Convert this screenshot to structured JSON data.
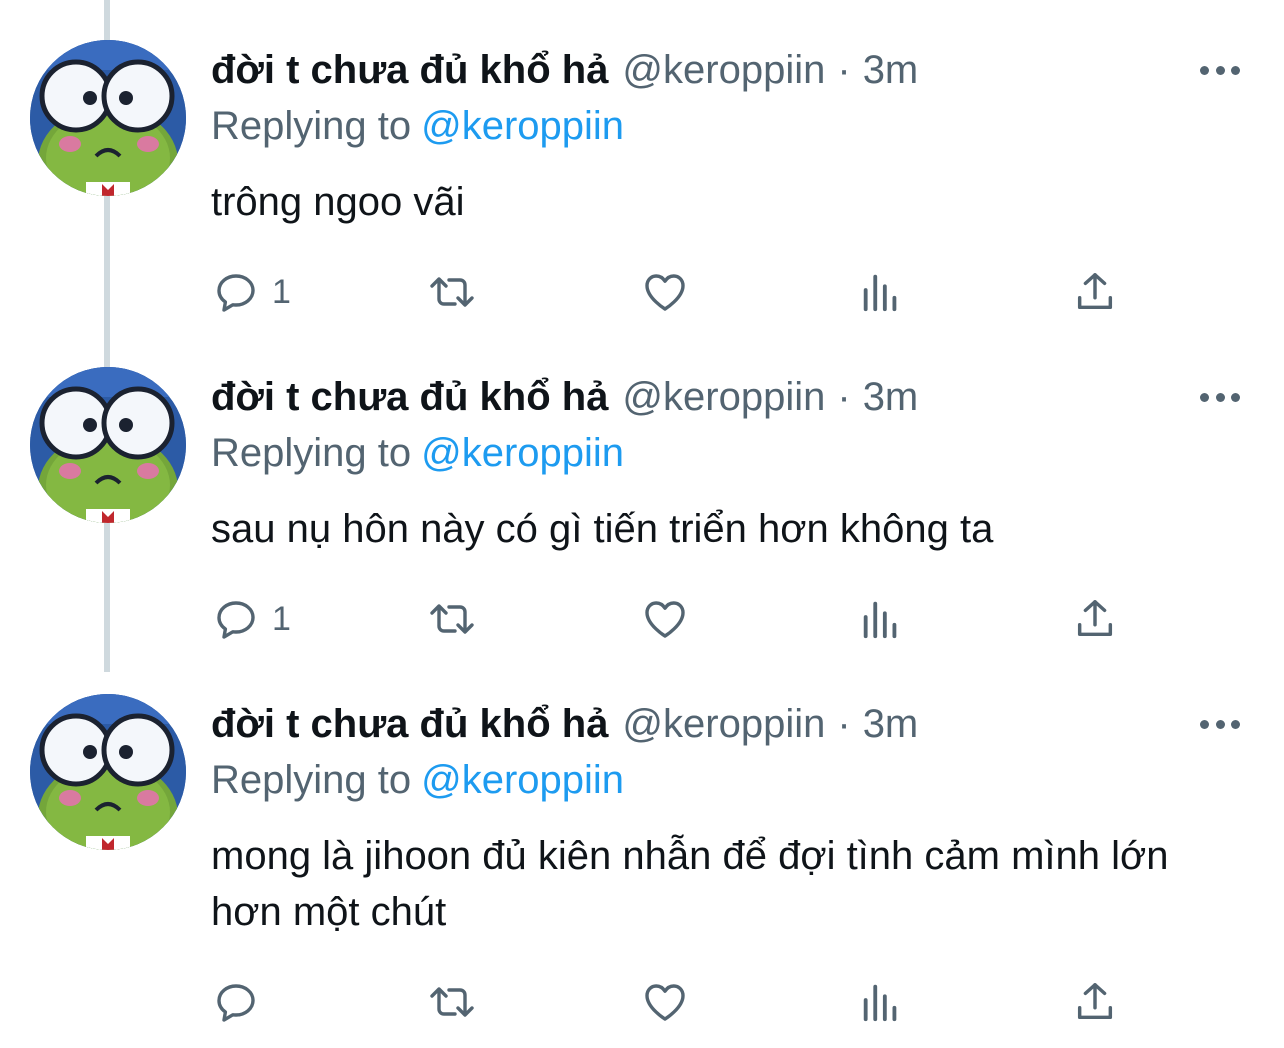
{
  "tweets": [
    {
      "name": "đời t chưa đủ khổ hả",
      "handle": "@keroppiin",
      "separator": "·",
      "time": "3m",
      "replying_prefix": "Replying to",
      "replying_to": "@keroppiin",
      "text": "trông ngoo vãi",
      "reply_count": "1"
    },
    {
      "name": "đời t chưa đủ khổ hả",
      "handle": "@keroppiin",
      "separator": "·",
      "time": "3m",
      "replying_prefix": "Replying to",
      "replying_to": "@keroppiin",
      "text": "sau nụ hôn này có gì tiến triển hơn không ta",
      "reply_count": "1"
    },
    {
      "name": "đời t chưa đủ khổ hả",
      "handle": "@keroppiin",
      "separator": "·",
      "time": "3m",
      "replying_prefix": "Replying to",
      "replying_to": "@keroppiin",
      "text": "mong là jihoon đủ kiên nhẫn để đợi tình cảm mình lớn hơn một chút",
      "reply_count": ""
    }
  ],
  "icons": {
    "reply": "reply-icon",
    "retweet": "retweet-icon",
    "like": "heart-icon",
    "views": "analytics-icon",
    "share": "share-icon",
    "more": "more-icon"
  },
  "colors": {
    "text": "#0f1419",
    "secondary": "#536471",
    "link": "#1d9bf0",
    "thread_line": "#cfd9de"
  }
}
